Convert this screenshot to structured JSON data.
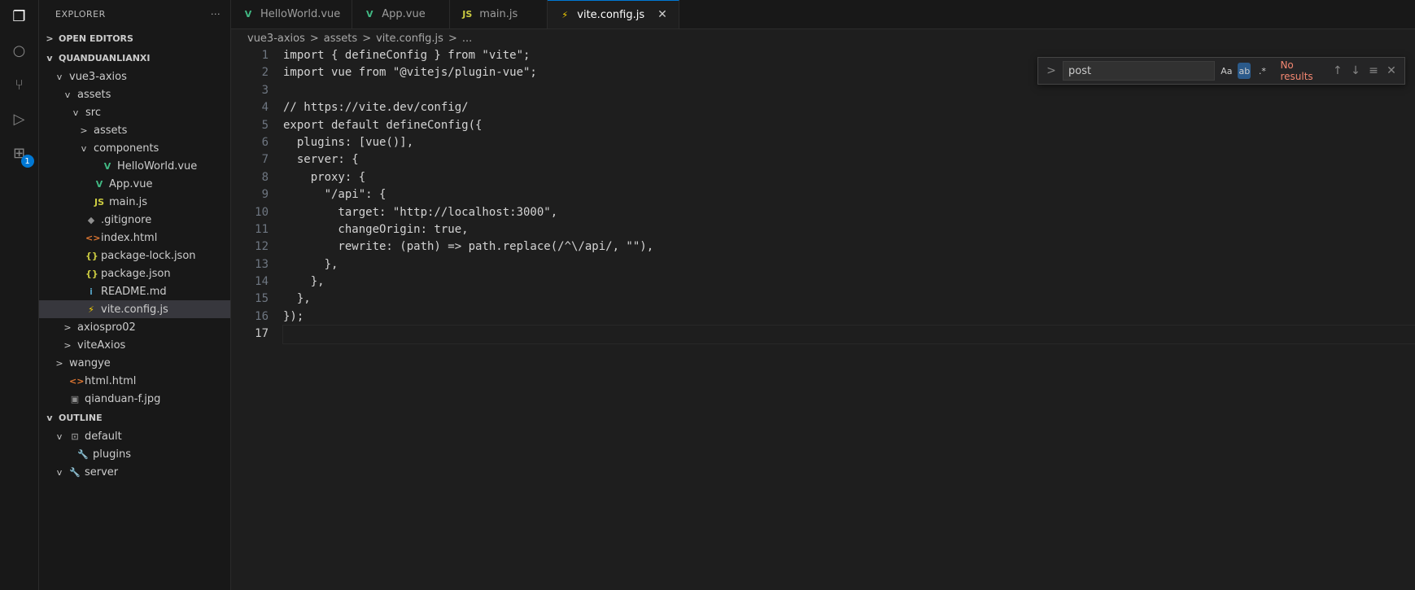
{
  "sidebar": {
    "title": "EXPLORER",
    "open_editors": "OPEN EDITORS",
    "project": "QUANDUANLIANXI",
    "tree": [
      {
        "label": "vue3-axios",
        "indent": 1,
        "chev": "v",
        "icon": ""
      },
      {
        "label": "assets",
        "indent": 2,
        "chev": "v",
        "icon": ""
      },
      {
        "label": "src",
        "indent": 3,
        "chev": "v",
        "icon": ""
      },
      {
        "label": "assets",
        "indent": 4,
        "chev": ">",
        "icon": ""
      },
      {
        "label": "components",
        "indent": 4,
        "chev": "v",
        "icon": ""
      },
      {
        "label": "HelloWorld.vue",
        "indent": 5,
        "chev": "",
        "icon": "V"
      },
      {
        "label": "App.vue",
        "indent": 4,
        "chev": "",
        "icon": "V"
      },
      {
        "label": "main.js",
        "indent": 4,
        "chev": "",
        "icon": "JS"
      },
      {
        "label": ".gitignore",
        "indent": 3,
        "chev": "",
        "icon": "◆"
      },
      {
        "label": "index.html",
        "indent": 3,
        "chev": "",
        "icon": "<>"
      },
      {
        "label": "package-lock.json",
        "indent": 3,
        "chev": "",
        "icon": "{}"
      },
      {
        "label": "package.json",
        "indent": 3,
        "chev": "",
        "icon": "{}"
      },
      {
        "label": "README.md",
        "indent": 3,
        "chev": "",
        "icon": "i"
      },
      {
        "label": "vite.config.js",
        "indent": 3,
        "chev": "",
        "icon": "⚡",
        "selected": true
      },
      {
        "label": "axiospro02",
        "indent": 2,
        "chev": ">",
        "icon": ""
      },
      {
        "label": "viteAxios",
        "indent": 2,
        "chev": ">",
        "icon": ""
      },
      {
        "label": "wangye",
        "indent": 1,
        "chev": ">",
        "icon": ""
      },
      {
        "label": "html.html",
        "indent": 1,
        "chev": "",
        "icon": "<>"
      },
      {
        "label": "qianduan-f.jpg",
        "indent": 1,
        "chev": "",
        "icon": "▣"
      }
    ],
    "outline": "OUTLINE",
    "outline_items": [
      {
        "label": "default",
        "indent": 1,
        "chev": "v",
        "icon": "⊡"
      },
      {
        "label": "plugins",
        "indent": 2,
        "chev": "",
        "icon": "🔧"
      },
      {
        "label": "server",
        "indent": 1,
        "chev": "v",
        "icon": "🔧"
      }
    ]
  },
  "activity": {
    "badge": "1"
  },
  "tabs": [
    {
      "label": "HelloWorld.vue",
      "icon": "V"
    },
    {
      "label": "App.vue",
      "icon": "V"
    },
    {
      "label": "main.js",
      "icon": "JS"
    },
    {
      "label": "vite.config.js",
      "icon": "⚡",
      "active": true
    }
  ],
  "breadcrumb": [
    "vue3-axios",
    "assets",
    "vite.config.js",
    "..."
  ],
  "find": {
    "value": "post",
    "case_label": "Aa",
    "word_label": "ab",
    "regex_label": ".*",
    "no_results": "No results"
  },
  "code": [
    "import { defineConfig } from \"vite\";",
    "import vue from \"@vitejs/plugin-vue\";",
    "",
    "// https://vite.dev/config/",
    "export default defineConfig({",
    "  plugins: [vue()],",
    "  server: {",
    "    proxy: {",
    "      \"/api\": {",
    "        target: \"http://localhost:3000\",",
    "        changeOrigin: true,",
    "        rewrite: (path) => path.replace(/^\\/api/, \"\"),",
    "      },",
    "    },",
    "  },",
    "});",
    ""
  ]
}
